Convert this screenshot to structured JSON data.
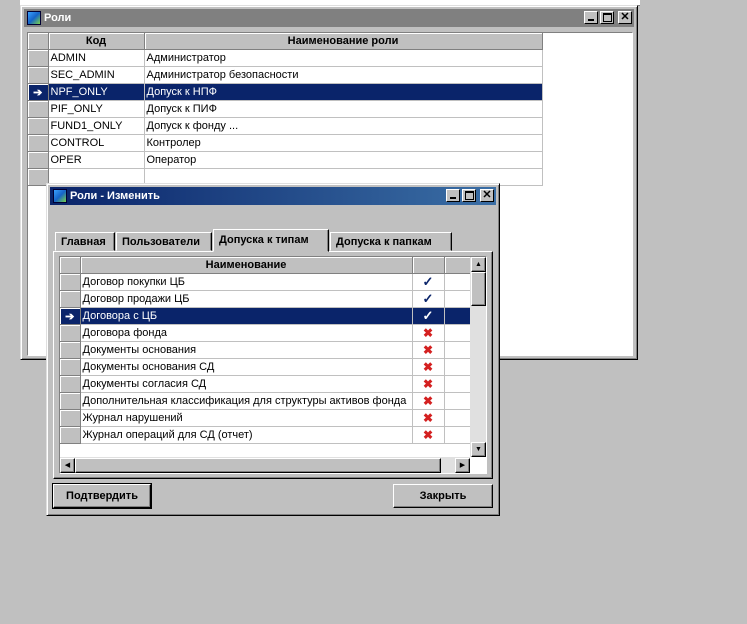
{
  "roles_window": {
    "title": "Роли",
    "columns": [
      "Код",
      "Наименование роли"
    ],
    "rows": [
      {
        "code": "ADMIN",
        "name": "Администратор",
        "selected": false
      },
      {
        "code": "SEC_ADMIN",
        "name": "Администратор безопасности",
        "selected": false
      },
      {
        "code": "NPF_ONLY",
        "name": "Допуск к НПФ",
        "selected": true
      },
      {
        "code": "PIF_ONLY",
        "name": "Допуск к ПИФ",
        "selected": false
      },
      {
        "code": "FUND1_ONLY",
        "name": "Допуск к фонду ...",
        "selected": false
      },
      {
        "code": "CONTROL",
        "name": "Контролер",
        "selected": false
      },
      {
        "code": "OPER",
        "name": "Оператор",
        "selected": false
      }
    ]
  },
  "edit_window": {
    "title": "Роли - Изменить",
    "tabs": [
      {
        "label": "Главная",
        "active": false
      },
      {
        "label": "Пользователи",
        "active": false
      },
      {
        "label": "Допуска к типам",
        "active": true
      },
      {
        "label": "Допуска к папкам",
        "active": false
      }
    ],
    "grid_header": "Наименование",
    "rows": [
      {
        "name": "Договор покупки ЦБ",
        "allowed": true,
        "selected": false
      },
      {
        "name": "Договор продажи ЦБ",
        "allowed": true,
        "selected": false
      },
      {
        "name": "Договора с ЦБ",
        "allowed": true,
        "selected": true
      },
      {
        "name": "Договора фонда",
        "allowed": false,
        "selected": false
      },
      {
        "name": "Документы основания",
        "allowed": false,
        "selected": false
      },
      {
        "name": "Документы основания СД",
        "allowed": false,
        "selected": false
      },
      {
        "name": "Документы согласия СД",
        "allowed": false,
        "selected": false
      },
      {
        "name": "Дополнительная классификация для структуры активов фонда",
        "allowed": false,
        "selected": false
      },
      {
        "name": "Журнал нарушений",
        "allowed": false,
        "selected": false
      },
      {
        "name": "Журнал операций для СД (отчет)",
        "allowed": false,
        "selected": false
      }
    ],
    "confirm_label": "Подтвердить",
    "close_label": "Закрыть"
  },
  "glyphs": {
    "row_pointer": "➔",
    "check": "✓",
    "cross": "✖",
    "scroll_up": "▲",
    "scroll_down": "▼",
    "scroll_left": "◀",
    "scroll_right": "▶",
    "close": "✕"
  },
  "colors": {
    "selection": "#0a246a",
    "check": "#0a246a",
    "cross": "#d42020",
    "face": "#c0c0c0"
  }
}
